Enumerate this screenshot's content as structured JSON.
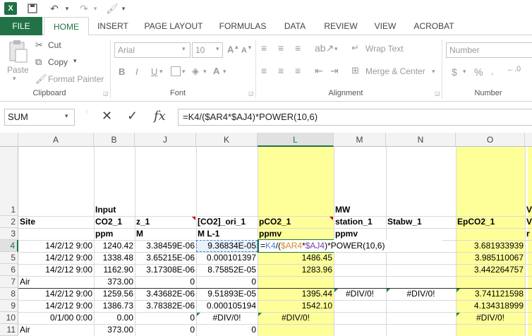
{
  "qat": {
    "undo_icon": "undo-icon",
    "redo_icon": "redo-icon"
  },
  "tabs": [
    "FILE",
    "HOME",
    "INSERT",
    "PAGE LAYOUT",
    "FORMULAS",
    "DATA",
    "REVIEW",
    "VIEW",
    "ACROBAT"
  ],
  "ribbon": {
    "clipboard": {
      "paste": "Paste",
      "cut": "Cut",
      "copy": "Copy",
      "format_painter": "Format Painter",
      "label": "Clipboard"
    },
    "font": {
      "font_name": "Arial",
      "font_size": "10",
      "bold": "B",
      "italic": "I",
      "underline": "U",
      "label": "Font"
    },
    "alignment": {
      "wrap_text": "Wrap Text",
      "merge_center": "Merge & Center",
      "label": "Alignment"
    },
    "number": {
      "format": "Number",
      "currency": "$",
      "percent": "%",
      "label": "Number"
    }
  },
  "formula_bar": {
    "name_box": "SUM",
    "cancel": "✕",
    "enter": "✓",
    "fx": "fx",
    "formula": "=K4/($AR4*$AJ4)*POWER(10,6)"
  },
  "columns": [
    "A",
    "B",
    "J",
    "K",
    "L",
    "M",
    "N",
    "O"
  ],
  "rows": [
    "1",
    "2",
    "3",
    "4",
    "5",
    "6",
    "7",
    "8",
    "9",
    "10",
    "11"
  ],
  "cells": {
    "r1": {
      "B": "Input",
      "M": "MW",
      "P": "V"
    },
    "r2": {
      "A": "Site",
      "B": "CO2_1",
      "J": "z_1",
      "K": "[CO2]_ori_1",
      "L": "pCO2_1",
      "M": "station_1",
      "N": "Stabw_1",
      "O": "EpCO2_1",
      "P": "V"
    },
    "r3": {
      "B": "ppm",
      "J": "M",
      "K": "M L-1",
      "L": "ppmv",
      "M": "ppmv",
      "P": "r"
    },
    "r4": {
      "A": "14/2/12 9:00",
      "B": "1240.42",
      "J": "3.38459E-06",
      "K": "9.36834E-05",
      "L_prefix": "=",
      "L_k4": "K4",
      "L_slash": "/(",
      "L_ar4": "$AR4",
      "L_star": "*",
      "L_aj4": "$AJ4",
      "L_rest": ")*POWER(10,6)",
      "O": "3.681933939"
    },
    "r5": {
      "A": "14/2/12 9:00",
      "B": "1338.48",
      "J": "3.65215E-06",
      "K": "0.000101397",
      "L": "1486.45",
      "O": "3.985110067"
    },
    "r6": {
      "A": "14/2/12 9:00",
      "B": "1162.90",
      "J": "3.17308E-06",
      "K": "8.75852E-05",
      "L": "1283.96",
      "O": "3.442264757"
    },
    "r7": {
      "A": "Air",
      "B": "373.00",
      "J": "0",
      "K": "0"
    },
    "r8": {
      "A": "14/2/12 9:00",
      "B": "1259.56",
      "J": "3.43682E-06",
      "K": "9.51893E-05",
      "L": "1395.44",
      "M": "#DIV/0!",
      "N": "#DIV/0!",
      "O": "3.741121598"
    },
    "r9": {
      "A": "14/2/12 9:00",
      "B": "1386.73",
      "J": "3.78382E-06",
      "K": "0.000105194",
      "L": "1542.10",
      "O": "4.134318999"
    },
    "r10": {
      "A": "0/1/00 0:00",
      "B": "0.00",
      "J": "0",
      "K": "#DIV/0!",
      "L": "#DIV/0!",
      "O": "#DIV/0!"
    },
    "r11": {
      "A": "Air",
      "B": "373.00",
      "J": "0",
      "K": "0"
    }
  },
  "colors": {
    "excel_green": "#217346",
    "highlight_yellow": "#ffff99",
    "ref_blue": "#4a7fd4",
    "ref_orange": "#d48a2a",
    "ref_purple": "#7a3fb0"
  }
}
